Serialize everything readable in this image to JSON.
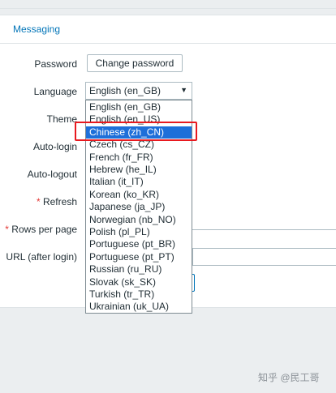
{
  "tab": {
    "label": "Messaging"
  },
  "form": {
    "password_label": "Password",
    "password_button": "Change password",
    "language_label": "Language",
    "language_value": "English (en_GB)",
    "theme_label": "Theme",
    "autologin_label": "Auto-login",
    "autologout_label": "Auto-logout",
    "required_mark": "*",
    "refresh_label": "Refresh",
    "rows_label": "Rows per page",
    "url_label": "URL (after login)"
  },
  "language_options": [
    "English (en_GB)",
    "English (en_US)",
    "Chinese (zh_CN)",
    "Czech (cs_CZ)",
    "French (fr_FR)",
    "Hebrew (he_IL)",
    "Italian (it_IT)",
    "Korean (ko_KR)",
    "Japanese (ja_JP)",
    "Norwegian (nb_NO)",
    "Polish (pl_PL)",
    "Portuguese (pt_BR)",
    "Portuguese (pt_PT)",
    "Russian (ru_RU)",
    "Slovak (sk_SK)",
    "Turkish (tr_TR)",
    "Ukrainian (uk_UA)"
  ],
  "selected_option": "Chinese (zh_CN)",
  "watermark": "知乎 @民工哥",
  "colors": {
    "accent": "#0275b8",
    "selected": "#1e6fd9",
    "highlight": "#e8191f"
  },
  "icons": {
    "select_arrow": "dropdown-arrow-icon"
  }
}
